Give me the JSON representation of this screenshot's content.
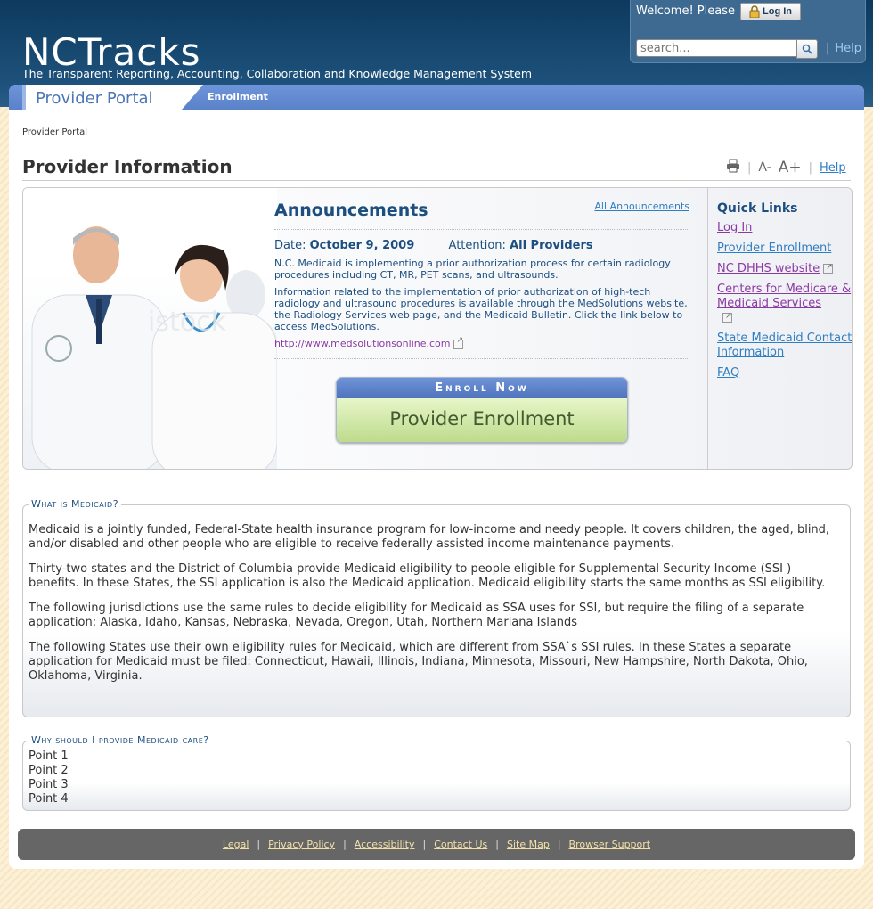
{
  "header": {
    "logo_title": "NCTracks",
    "logo_tagline": "The Transparent Reporting, Accounting, Collaboration and Knowledge Management System",
    "welcome_text": "Welcome! Please",
    "login_label": "Log In",
    "search_placeholder": "search...",
    "help_label": "Help"
  },
  "nav": {
    "portal_label": "Provider Portal",
    "enrollment_label": "Enrollment"
  },
  "breadcrumb": "Provider Portal",
  "page_title": "Provider Information",
  "tools": {
    "font_decrease": "A-",
    "font_increase": "A+",
    "help_label": "Help"
  },
  "announcements": {
    "title": "Announcements",
    "all_link": "All Announcements",
    "date_label": "Date:",
    "date_value": "October 9, 2009",
    "attention_label": "Attention:",
    "attention_value": "All Providers",
    "para1": "N.C. Medicaid is implementing a prior authorization process for certain radiology procedures including CT, MR, PET scans, and ultrasounds.",
    "para2": "Information related to the implementation of prior authorization of high-tech radiology and ultrasound procedures is available through the MedSolutions website, the Radiology Services web page, and the Medicaid Bulletin. Click the link below to access MedSolutions.",
    "link": "http://www.medsolutionsonline.com"
  },
  "enroll": {
    "top_label": "Enroll Now",
    "main_label": "Provider Enrollment"
  },
  "quick_links": {
    "title": "Quick Links",
    "items": [
      {
        "label": "Log In"
      },
      {
        "label": "Provider Enrollment"
      },
      {
        "label": "NC DHHS website"
      },
      {
        "label": "Centers for Medicare & Medicaid Services"
      },
      {
        "label": "State Medicaid Contact Information"
      },
      {
        "label": "FAQ"
      }
    ]
  },
  "medicaid": {
    "legend": "What is Medicaid?",
    "paragraphs": [
      "Medicaid is a jointly funded, Federal-State health insurance program for low-income and needy people. It covers children, the aged, blind, and/or disabled and other people who are eligible to receive federally assisted income maintenance payments.",
      "Thirty-two states and the District of Columbia provide Medicaid eligibility to people eligible for Supplemental Security Income (SSI ) benefits. In these States, the SSI application is also the Medicaid application. Medicaid eligibility starts the same months as SSI eligibility.",
      "The following jurisdictions use the same rules to decide eligibility for Medicaid as SSA uses for SSI, but require the filing of a separate application: Alaska, Idaho, Kansas, Nebraska, Nevada, Oregon, Utah, Northern Mariana Islands",
      "The following States use their own eligibility rules for Medicaid, which are different from SSA`s SSI rules. In these States a separate application for Medicaid must be filed: Connecticut, Hawaii, Illinois, Indiana, Minnesota, Missouri, New Hampshire, North Dakota, Ohio, Oklahoma, Virginia."
    ]
  },
  "why": {
    "legend": "Why should I provide Medicaid care?",
    "points": [
      "Point 1",
      "Point 2",
      "Point 3",
      "Point 4"
    ]
  },
  "footer": {
    "links": [
      "Legal",
      "Privacy Policy",
      "Accessibility",
      "Contact Us",
      "Site Map",
      "Browser Support"
    ]
  },
  "colors": {
    "header_navy": "#0d3a5e",
    "nav_blue": "#5a82c9",
    "link_blue": "#2e7ec2",
    "visited_purple": "#8b3aa3",
    "heading_blue": "#1c4e80"
  }
}
